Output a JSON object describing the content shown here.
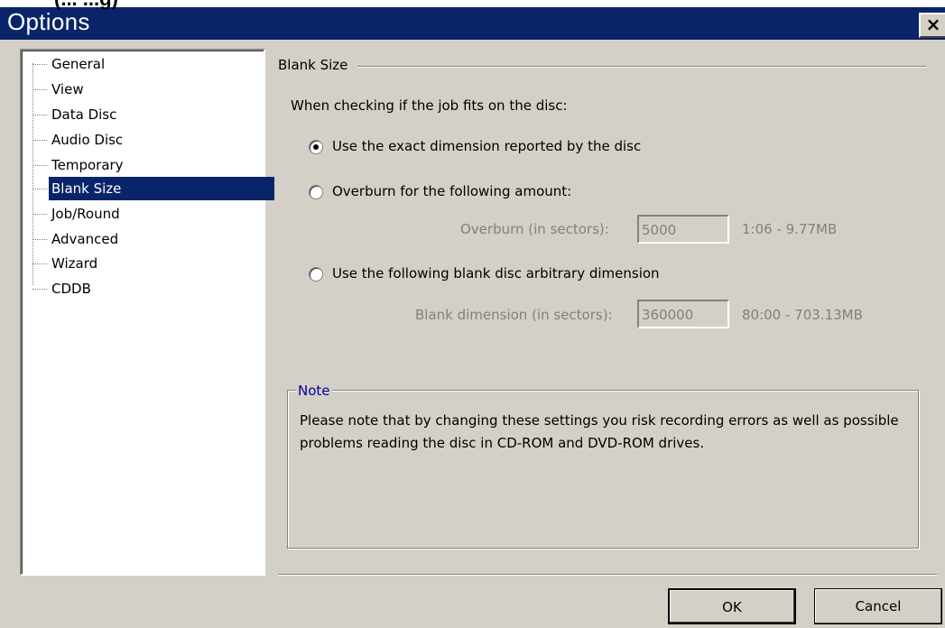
{
  "window": {
    "top_strip_text": "(... ...g)",
    "title": "Options",
    "close_label": "×"
  },
  "nav": {
    "items": [
      {
        "label": "General"
      },
      {
        "label": "View"
      },
      {
        "label": "Data Disc"
      },
      {
        "label": "Audio Disc"
      },
      {
        "label": "Temporary"
      },
      {
        "label": "Blank Size",
        "selected": true
      },
      {
        "label": "Job/Round"
      },
      {
        "label": "Advanced"
      },
      {
        "label": "Wizard"
      },
      {
        "label": "CDDB"
      }
    ]
  },
  "blank_size": {
    "group_title": "Blank Size",
    "prompt": "When checking if the job fits on the disc:",
    "option_exact": "Use the exact dimension reported by the disc",
    "option_overburn": "Overburn for the following amount:",
    "overburn_label": "Overburn (in sectors):",
    "overburn_value": "5000",
    "overburn_info": "1:06 - 9.77MB",
    "option_arbitrary": "Use the following blank disc arbitrary dimension",
    "blank_label": "Blank dimension (in sectors):",
    "blank_value": "360000",
    "blank_info": "80:00 - 703.13MB",
    "selected_option": "exact"
  },
  "note": {
    "title": "Note",
    "text": "Please note that by changing these settings you risk recording errors as well as possible problems reading the disc in CD-ROM and DVD-ROM drives."
  },
  "buttons": {
    "ok": "OK",
    "cancel": "Cancel"
  }
}
